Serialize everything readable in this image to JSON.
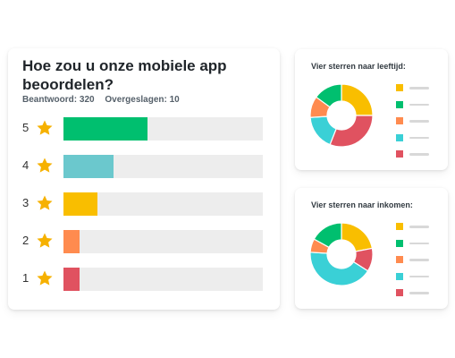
{
  "survey": {
    "question": "Hoe zou u onze mobiele app beoordelen?",
    "answered": "Beantwoord: 320",
    "skipped": "Overgeslagen: 10",
    "ratings": [
      {
        "label": "5",
        "value": 0.42,
        "color": "#00bf6f"
      },
      {
        "label": "4",
        "value": 0.25,
        "color": "#6bc8cd"
      },
      {
        "label": "3",
        "value": 0.17,
        "color": "#f9be00"
      },
      {
        "label": "2",
        "value": 0.08,
        "color": "#ff8b4f"
      },
      {
        "label": "1",
        "value": 0.08,
        "color": "#e05260"
      }
    ]
  },
  "star_color": "#f6b100",
  "track_color": "#ededed",
  "side_panels": [
    {
      "title": "Vier sterren naar leeftijd:",
      "segments": [
        {
          "color": "#f9be00",
          "value": 0.25
        },
        {
          "color": "#e05260",
          "value": 0.31
        },
        {
          "color": "#3ad0d6",
          "value": 0.18
        },
        {
          "color": "#ff8b4f",
          "value": 0.11
        },
        {
          "color": "#00bf6f",
          "value": 0.15
        }
      ],
      "legend": [
        "#f9be00",
        "#00bf6f",
        "#ff8b4f",
        "#3ad0d6",
        "#e05260"
      ]
    },
    {
      "title": "Vier sterren naar inkomen:",
      "segments": [
        {
          "color": "#f9be00",
          "value": 0.22
        },
        {
          "color": "#e05260",
          "value": 0.12
        },
        {
          "color": "#3ad0d6",
          "value": 0.42
        },
        {
          "color": "#ff8b4f",
          "value": 0.07
        },
        {
          "color": "#00bf6f",
          "value": 0.17
        }
      ],
      "legend": [
        "#f9be00",
        "#00bf6f",
        "#ff8b4f",
        "#3ad0d6",
        "#e05260"
      ]
    }
  ]
}
